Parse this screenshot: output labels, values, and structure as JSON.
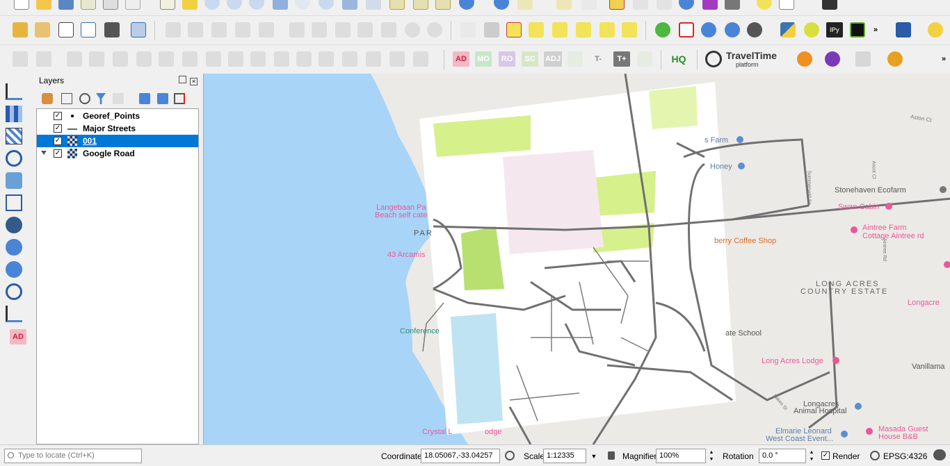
{
  "layers_panel": {
    "title": "Layers",
    "items": [
      {
        "name": "Georef_Points",
        "checked": true,
        "symbol": "point"
      },
      {
        "name": "Major Streets",
        "checked": true,
        "symbol": "line"
      },
      {
        "name": "001",
        "checked": true,
        "symbol": "raster",
        "selected": true
      },
      {
        "name": "Google Road",
        "checked": true,
        "symbol": "raster"
      }
    ]
  },
  "toolbar3": {
    "ad": "AD",
    "mo": "MO",
    "ro": "RO",
    "sc": "SC",
    "adj": "ADJ",
    "t_minus": "T-",
    "t_plus": "T+",
    "hq": "HQ",
    "traveltime_title": "TravelTime",
    "traveltime_sub": "platform",
    "more": "»"
  },
  "toolbar2": {
    "ipy": "IPy",
    "more": "»"
  },
  "left_tools": {
    "ad": "AD"
  },
  "map_labels": {
    "farm": "s Farm",
    "honey": "Honey",
    "stonehaven": "Stonehaven Ecofarm",
    "swan_cabin": "Swan Cabin",
    "aintree": "Aintree Farm",
    "aintree2": "Cottage Aintree rd",
    "langebaan1": "Langebaan Pa",
    "langebaan2": "Beach self cate",
    "par": "PAR",
    "arcamis": "43 Arcamis",
    "coffee": "berry Coffee Shop",
    "long_acres": "LONG ACRES",
    "country_estate": "COUNTRY ESTATE",
    "longacre": "Longacre",
    "state_school": "ate School",
    "conference": "Conference",
    "long_acres_lodge": "Long Acres Lodge",
    "vanillama": "Vanillama",
    "longacres_animal1": "Longacres",
    "longacres_animal2": "Animal Hospital",
    "crystal": "Crystal L",
    "lodge": "odge",
    "elmarie1": "Elmarie Leonard",
    "elmarie2": "West Coast Event...",
    "masada1": "Masada Guest",
    "masada2": "House B&B",
    "aston": "Aston Ct",
    "summerveld": "Summerveld St",
    "ascot": "Ascot Cl",
    "aintree_rd": "Aintree Rd",
    "lakes_st": "Lakes St"
  },
  "statusbar": {
    "locate_placeholder": "Type to locate (Ctrl+K)",
    "coordinate_label": "Coordinate",
    "coordinate_value": "18.05067,-33.04257",
    "scale_label": "Scale",
    "scale_value": "1:12335",
    "magnifier_label": "Magnifier",
    "magnifier_value": "100%",
    "rotation_label": "Rotation",
    "rotation_value": "0.0 °",
    "render_label": "Render",
    "render_checked": true,
    "crs": "EPSG:4326"
  },
  "colors": {
    "water": "#a8d4f8",
    "selected": "#0078d7",
    "raster_green": "#d6f08c",
    "street": "#707070",
    "poi_pink": "#e8589a",
    "poi_blue": "#5b8fd0"
  }
}
